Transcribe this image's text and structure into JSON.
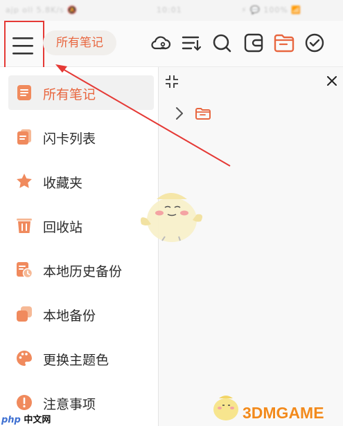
{
  "status_bar": {
    "left": "ajp oll 5.8K/s 🔕",
    "center": "10:01",
    "right": "⚡ 💬 100% 📶"
  },
  "toolbar": {
    "menu_icon": "hamburger-icon",
    "title": "所有笔记",
    "icons": [
      "cloud-user-icon",
      "sort-icon",
      "search-icon",
      "wallet-icon",
      "folder-icon",
      "check-circle-icon"
    ]
  },
  "drawer": {
    "items": [
      {
        "label": "所有笔记",
        "icon": "notes-icon",
        "active": true
      },
      {
        "label": "闪卡列表",
        "icon": "flashcards-icon",
        "active": false
      },
      {
        "label": "收藏夹",
        "icon": "star-icon",
        "active": false
      },
      {
        "label": "回收站",
        "icon": "trash-icon",
        "active": false
      },
      {
        "label": "本地历史备份",
        "icon": "history-backup-icon",
        "active": false
      },
      {
        "label": "本地备份",
        "icon": "backup-icon",
        "active": false
      },
      {
        "label": "更换主题色",
        "icon": "palette-icon",
        "active": false
      },
      {
        "label": "注意事项",
        "icon": "alert-icon",
        "active": false
      }
    ]
  },
  "pane": {
    "icons": [
      "collapse-icon",
      "close-icon",
      "chevron-right-icon",
      "folder-icon"
    ]
  },
  "watermarks": {
    "left_brand": "php",
    "left_text": "中文网",
    "right_text": "3DMGAME"
  },
  "colors": {
    "accent": "#e8663f",
    "annotation": "#e53935",
    "icon_orange": "#f08a5d"
  }
}
